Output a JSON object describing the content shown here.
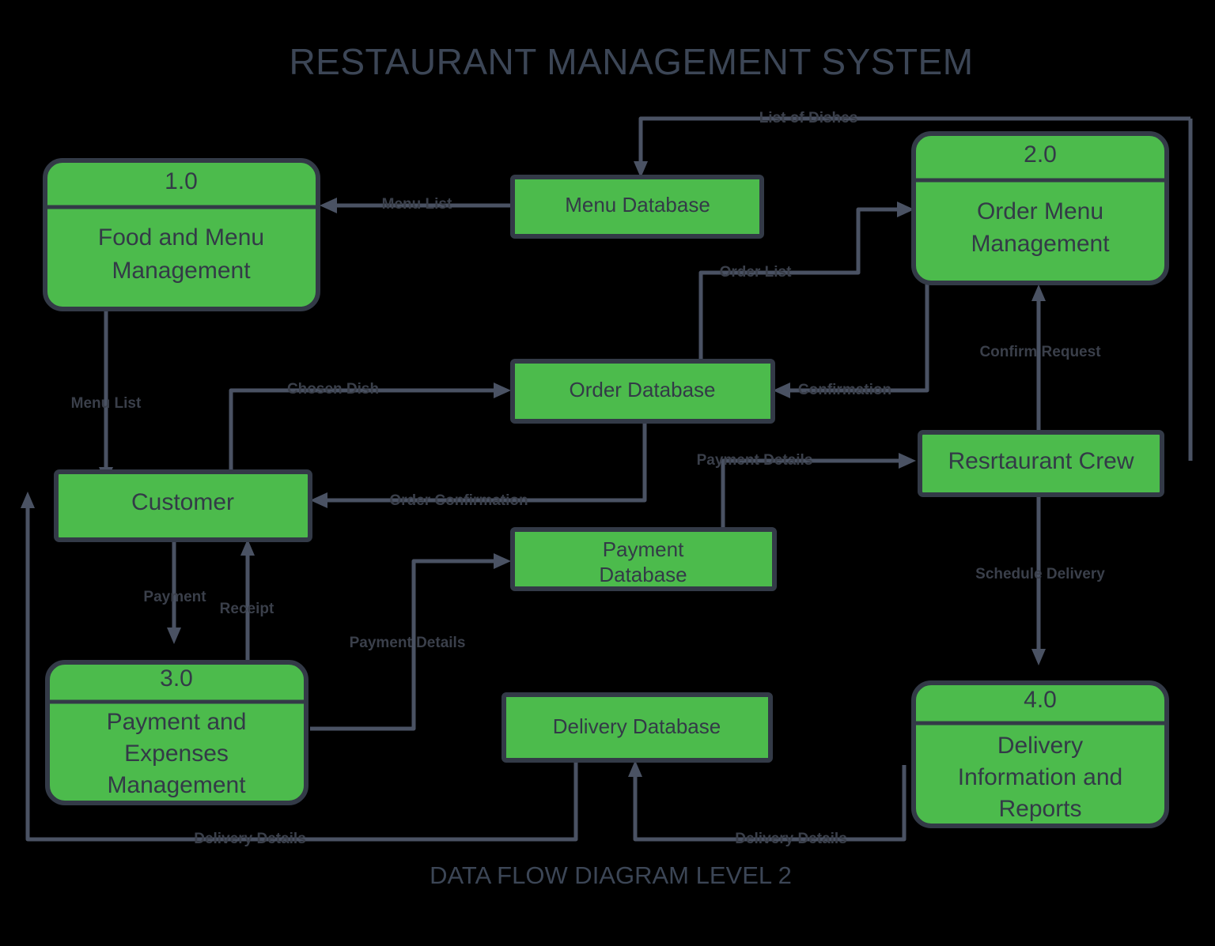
{
  "diagram": {
    "title": "RESTAURANT  MANAGEMENT SYSTEM",
    "footer": "DATA FLOW DIAGRAM LEVEL 2",
    "colors": {
      "node_fill": "#4cbb4c",
      "node_border": "#333a47",
      "flow_line": "#4a5263",
      "text": "#333a47",
      "title_text": "#3c4656",
      "background": "#000000"
    },
    "processes": [
      {
        "id": "p1",
        "number": "1.0",
        "line1": "Food and Menu",
        "line2": "Management",
        "line3": ""
      },
      {
        "id": "p2",
        "number": "2.0",
        "line1": "Order Menu",
        "line2": "Management",
        "line3": ""
      },
      {
        "id": "p3",
        "number": "3.0",
        "line1": "Payment and",
        "line2": "Expenses",
        "line3": "Management"
      },
      {
        "id": "p4",
        "number": "4.0",
        "line1": "Delivery",
        "line2": "Information and",
        "line3": "Reports"
      }
    ],
    "entities": [
      {
        "id": "e_customer",
        "label": "Customer"
      },
      {
        "id": "e_crew",
        "label": "Resrtaurant Crew"
      }
    ],
    "datastores": [
      {
        "id": "ds_menu",
        "label": "Menu Database",
        "line1": "Menu Database",
        "line2": ""
      },
      {
        "id": "ds_order",
        "label": "Order Database",
        "line1": "Order Database",
        "line2": ""
      },
      {
        "id": "ds_payment",
        "label": "Payment Database",
        "line1": "Payment",
        "line2": "Database"
      },
      {
        "id": "ds_delivery",
        "label": "Delivery Database",
        "line1": "Delivery Database",
        "line2": ""
      }
    ],
    "flows": [
      {
        "id": "f_list_of_dishes",
        "label": "List of Dishes",
        "from": "ds_order_right_loop",
        "to": "ds_menu"
      },
      {
        "id": "f_menu_list_top",
        "label": "Menu List",
        "from": "ds_menu",
        "to": "p1"
      },
      {
        "id": "f_menu_list_left",
        "label": "Menu List",
        "from": "p1",
        "to": "e_customer"
      },
      {
        "id": "f_order_list",
        "label": "Order List",
        "from": "ds_order",
        "to": "p2"
      },
      {
        "id": "f_chosen_dish",
        "label": "Chosen Dish",
        "from": "e_customer",
        "to": "ds_order"
      },
      {
        "id": "f_confirmation",
        "label": "Confirmation",
        "from": "p2",
        "to": "ds_order"
      },
      {
        "id": "f_confirm_request",
        "label": "Confirm Request",
        "from": "e_crew",
        "to": "p2"
      },
      {
        "id": "f_order_confirmation",
        "label": "Order Confirmation",
        "from": "ds_order",
        "to": "e_customer"
      },
      {
        "id": "f_payment_details_crew",
        "label": "Payment Details",
        "from": "ds_payment",
        "to": "e_crew"
      },
      {
        "id": "f_payment",
        "label": "Payment",
        "from": "e_customer",
        "to": "p3"
      },
      {
        "id": "f_receipt",
        "label": "Receipt",
        "from": "p3",
        "to": "e_customer"
      },
      {
        "id": "f_payment_details_db",
        "label": "Payment Details",
        "from": "p3",
        "to": "ds_payment"
      },
      {
        "id": "f_schedule_delivery",
        "label": "Schedule Delivery",
        "from": "e_crew",
        "to": "p4"
      },
      {
        "id": "f_delivery_details_left",
        "label": "Delivery Details",
        "from": "ds_delivery",
        "to": "e_customer"
      },
      {
        "id": "f_delivery_details_right",
        "label": "Delivery Details",
        "from": "p4",
        "to": "ds_delivery"
      }
    ]
  }
}
